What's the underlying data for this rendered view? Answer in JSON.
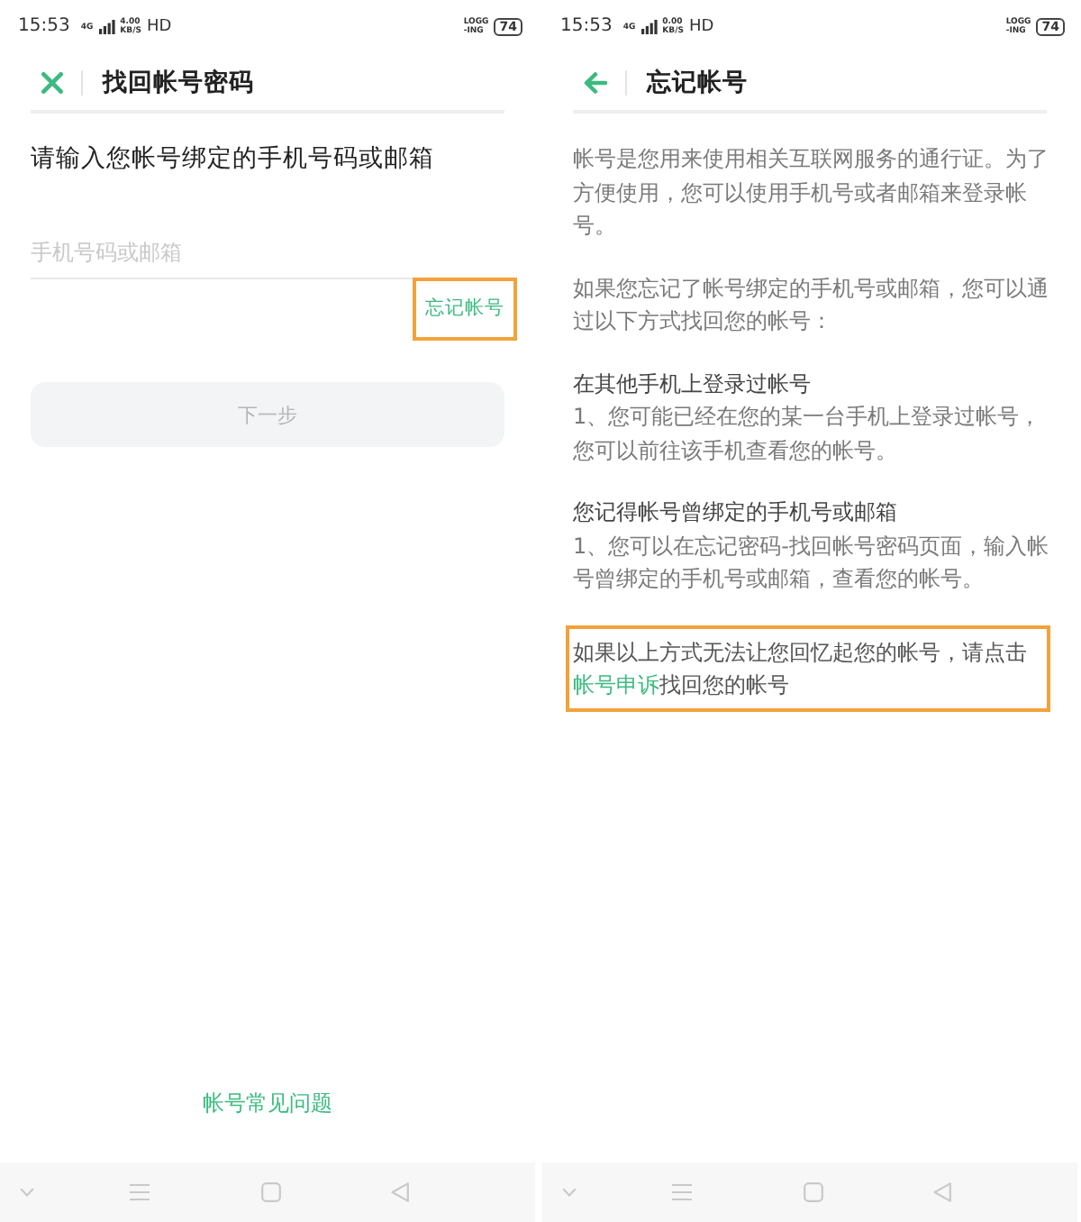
{
  "left_screen": {
    "status_bar": {
      "time": "15:53",
      "network_type": "4G",
      "speed_value": "4.00",
      "speed_unit": "KB/S",
      "network": "HD",
      "recording": [
        "LOGG",
        "-ING"
      ],
      "battery": "74"
    },
    "header": {
      "title": "找回帐号密码"
    },
    "prompt": "请输入您帐号绑定的手机号码或邮箱",
    "account_field": {
      "placeholder": "手机号码或邮箱"
    },
    "forgot_account_link": {
      "label": "忘记帐号",
      "highlighted": true
    },
    "next_button": {
      "label": "下一步",
      "disabled": true
    },
    "faq_link": "帐号常见问题"
  },
  "right_screen": {
    "status_bar": {
      "time": "15:53",
      "network_type": "4G",
      "speed_value": "0.00",
      "speed_unit": "KB/S",
      "network": "HD",
      "recording": [
        "LOGG",
        "-ING"
      ],
      "battery": "74"
    },
    "header": {
      "title": "忘记帐号"
    },
    "blocks": [
      {
        "kind": "paragraph",
        "text": "帐号是您用来使用相关互联网服务的通行证。为了方便使用，您可以使用手机号或者邮箱来登录帐号。"
      },
      {
        "kind": "paragraph",
        "text": "如果您忘记了帐号绑定的手机号或邮箱，您可以通过以下方式找回您的帐号："
      },
      {
        "kind": "method",
        "heading": "在其他手机上登录过帐号",
        "text": "1、您可能已经在您的某一台手机上登录过帐号，您可以前往该手机查看您的帐号。"
      },
      {
        "kind": "method",
        "heading": "您记得帐号曾绑定的手机号或邮箱",
        "text": "1、您可以在忘记密码-找回帐号密码页面，输入帐号曾绑定的手机号或邮箱，查看您的帐号。"
      },
      {
        "kind": "notice",
        "text_before": "如果以上方式无法让您回忆起您的帐号，请点击",
        "link": "帐号申诉",
        "text_after": "找回您的帐号",
        "highlighted": true
      }
    ]
  }
}
